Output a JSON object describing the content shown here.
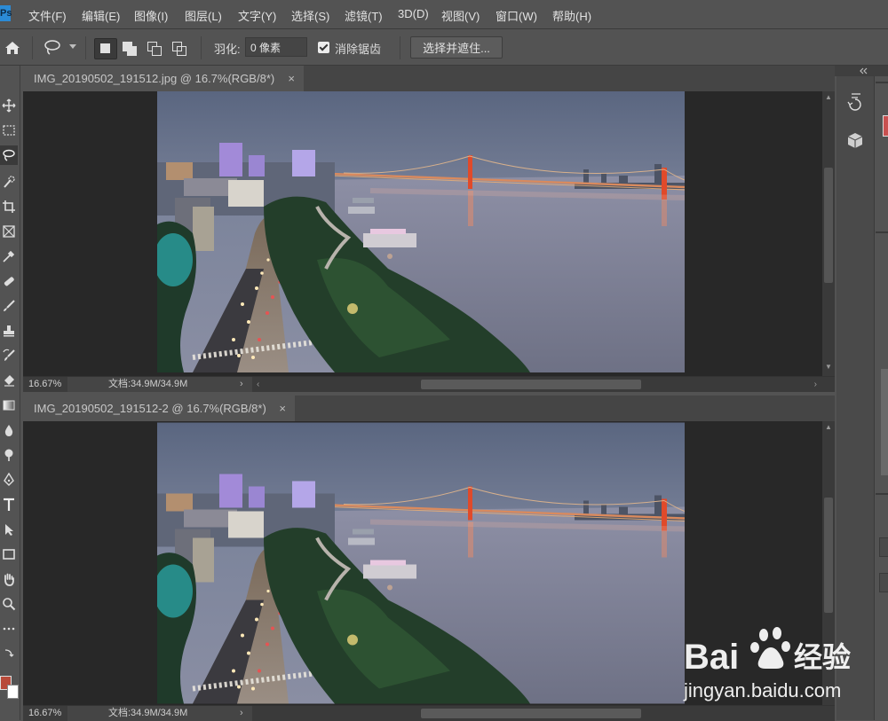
{
  "app": {
    "icon_label": "Ps"
  },
  "menu": [
    "文件(F)",
    "编辑(E)",
    "图像(I)",
    "图层(L)",
    "文字(Y)",
    "选择(S)",
    "滤镜(T)",
    "3D(D)",
    "视图(V)",
    "窗口(W)",
    "帮助(H)"
  ],
  "options": {
    "feather_label": "羽化:",
    "feather_value": "0 像素",
    "antialias_label": "消除锯齿",
    "antialias_checked": true,
    "select_mask_button": "选择并遮住..."
  },
  "documents": [
    {
      "tab_title": "IMG_20190502_191512.jpg @ 16.7%(RGB/8*)",
      "close": "×",
      "zoom": "16.67%",
      "doc_size": "文档:34.9M/34.9M",
      "status_arrow": "›"
    },
    {
      "tab_title": "IMG_20190502_191512-2 @ 16.7%(RGB/8*)",
      "close": "×",
      "zoom": "16.67%",
      "doc_size": "文档:34.9M/34.9M",
      "status_arrow": "›"
    }
  ],
  "tools": [
    "move-tool",
    "marquee-tool",
    "lasso-tool",
    "quick-selection-tool",
    "crop-tool",
    "frame-tool",
    "eyedropper-tool",
    "healing-brush-tool",
    "brush-tool",
    "clone-stamp-tool",
    "history-brush-tool",
    "eraser-tool",
    "gradient-tool",
    "blur-tool",
    "dodge-tool",
    "pen-tool",
    "type-tool",
    "path-selection-tool",
    "rectangle-tool",
    "hand-tool",
    "zoom-tool",
    "more-tools"
  ],
  "colors": {
    "foreground": "#b84a3a",
    "background": "#ffffff",
    "ui_bg": "#535353",
    "canvas_bg": "#282828"
  },
  "watermark": {
    "brand": "Bai",
    "brand_suffix": "经验",
    "url": "jingyan.baidu.com"
  }
}
